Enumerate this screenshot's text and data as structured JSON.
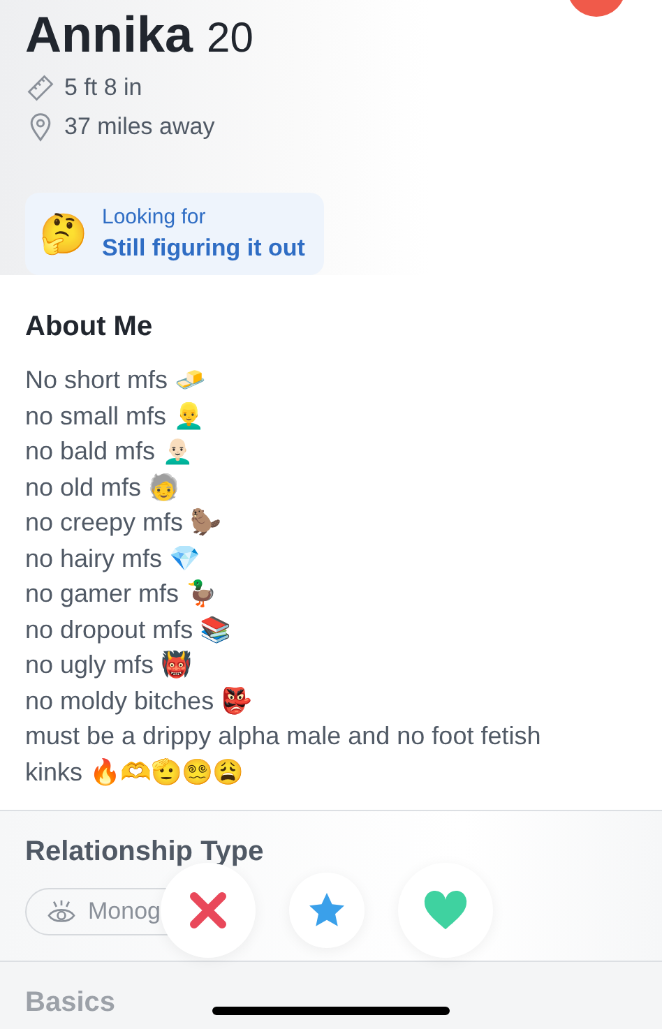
{
  "header": {
    "name": "Annika",
    "age": "20"
  },
  "details": [
    {
      "kind": "height",
      "text": "5 ft 8 in"
    },
    {
      "kind": "distance",
      "text": "37 miles away"
    }
  ],
  "looking_for": {
    "emoji": "🤔",
    "label": "Looking for",
    "value": "Still figuring it out"
  },
  "about": {
    "title": "About Me",
    "lines": [
      "No short mfs 🧈",
      "no small mfs 👱‍♂️",
      "no bald mfs 👨🏻‍🦲",
      "no old mfs 🧓",
      "no creepy mfs 🦫",
      "no hairy mfs 💎",
      "no gamer mfs 🦆",
      "no dropout mfs 📚",
      "no ugly mfs 👹",
      "no moldy bitches 👺",
      "must be a drippy alpha male and no foot fetish kinks 🔥🫶🫡😵‍💫😩"
    ]
  },
  "relationship": {
    "title": "Relationship Type",
    "chip": "Monog"
  },
  "basics": {
    "title": "Basics"
  },
  "actions": [
    {
      "kind": "nope"
    },
    {
      "kind": "super_like"
    },
    {
      "kind": "like"
    }
  ]
}
